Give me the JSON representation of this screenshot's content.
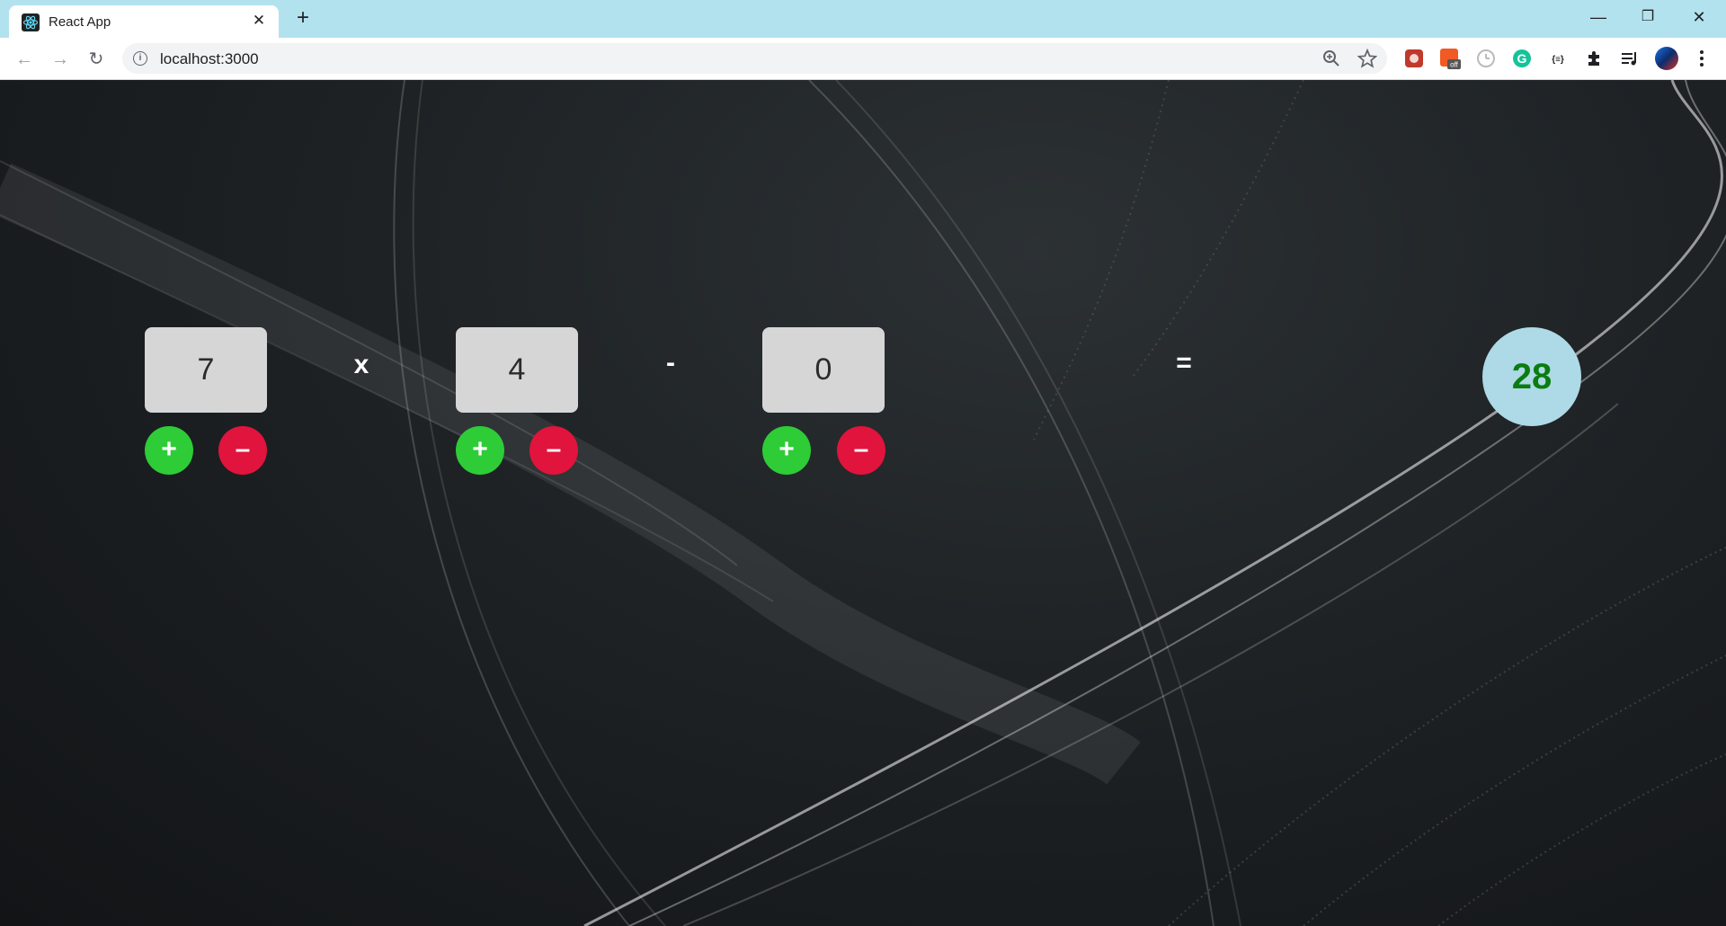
{
  "browser": {
    "tab_title": "React App",
    "tab_close": "✕",
    "new_tab": "+",
    "window_controls": {
      "minimize": "—",
      "restore": "❐",
      "close": "✕"
    },
    "nav": {
      "back": "←",
      "forward": "→",
      "reload": "↻"
    },
    "url": "localhost:3000",
    "extensions": [
      "ext-red-icon",
      "ext-orange-off-icon",
      "ext-clock-icon",
      "grammarly-icon",
      "json-icon",
      "puzzle-icon",
      "media-icon",
      "profile-avatar"
    ],
    "extension_badge": "off",
    "json_ext_label": "{≡}"
  },
  "calculator": {
    "operand1": "7",
    "operand2": "4",
    "operand3": "0",
    "op1": "x",
    "op2": "-",
    "equals": "=",
    "result": "28",
    "plus_label": "+",
    "minus_label": "–"
  },
  "colors": {
    "plus": "#2ecc37",
    "minus": "#e0143c",
    "result_bg": "#aed9e6",
    "result_text": "#0a7d10",
    "tabbar": "#b3e2ef"
  }
}
